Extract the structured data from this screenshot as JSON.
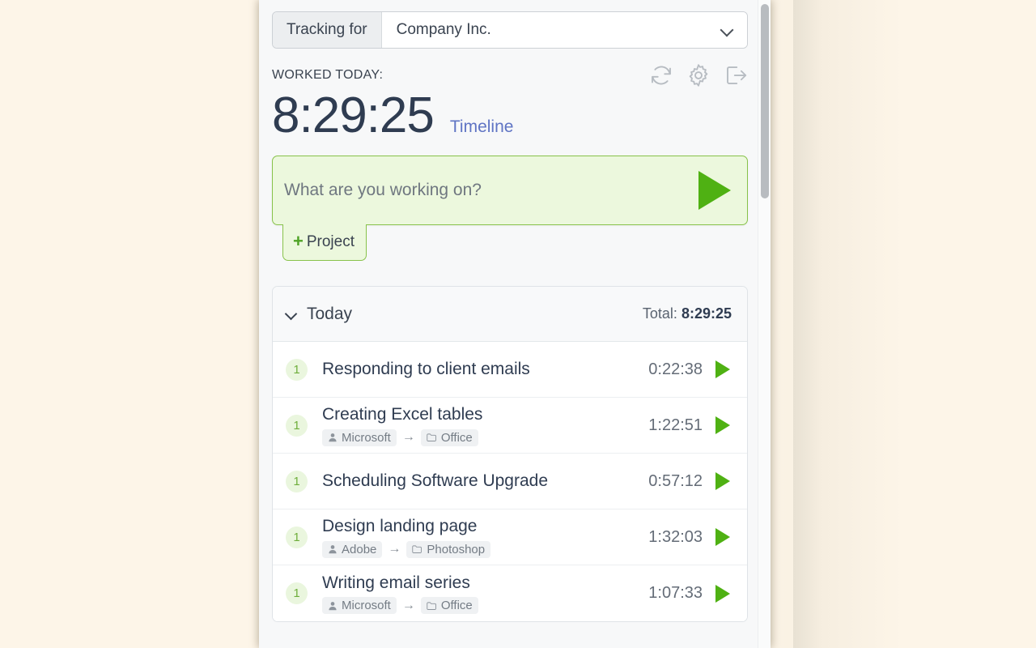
{
  "app": {
    "tracking": {
      "label": "Tracking for",
      "selected_value": "Company Inc.",
      "chevron_icon": "chevron-down-icon"
    },
    "worked": {
      "label": "WORKED TODAY:",
      "timer": "8:29:25",
      "timeline_link": "Timeline"
    },
    "top_icons": [
      {
        "name": "refresh-icon"
      },
      {
        "name": "settings-gear-icon"
      },
      {
        "name": "logout-icon"
      }
    ],
    "entry_input": {
      "value": "",
      "placeholder": "What are you working on?",
      "start_button_icon": "play-icon"
    },
    "project_tab": {
      "plus": "+",
      "label": "Project"
    },
    "entries_group": {
      "day_label": "Today",
      "total_label": "Total:",
      "total_value": "8:29:25",
      "collapse_icon": "chevron-down-icon",
      "rows": [
        {
          "count": "1",
          "title": "Responding to client emails",
          "client": null,
          "project": null,
          "time": "0:22:38",
          "play_icon": "play-icon"
        },
        {
          "count": "1",
          "title": "Creating Excel tables",
          "client": "Microsoft",
          "project": "Office",
          "time": "1:22:51",
          "play_icon": "play-icon"
        },
        {
          "count": "1",
          "title": "Scheduling Software Upgrade",
          "client": null,
          "project": null,
          "time": "0:57:12",
          "play_icon": "play-icon"
        },
        {
          "count": "1",
          "title": "Design landing page",
          "client": "Adobe",
          "project": "Photoshop",
          "time": "1:32:03",
          "play_icon": "play-icon"
        },
        {
          "count": "1",
          "title": "Writing email series",
          "client": "Microsoft",
          "project": "Office",
          "time": "1:07:33",
          "play_icon": "play-icon"
        }
      ]
    },
    "meta_arrow": "→"
  },
  "colors": {
    "page_background": "#fdf5e8",
    "accent_green": "#4fb113",
    "green_panel_bg": "#ecf8dd",
    "green_border": "#88c24a",
    "timer_text": "#2f3c51",
    "link_blue": "#5f74c4",
    "badge_bg": "#eaf6de",
    "badge_text": "#6fae3c"
  }
}
